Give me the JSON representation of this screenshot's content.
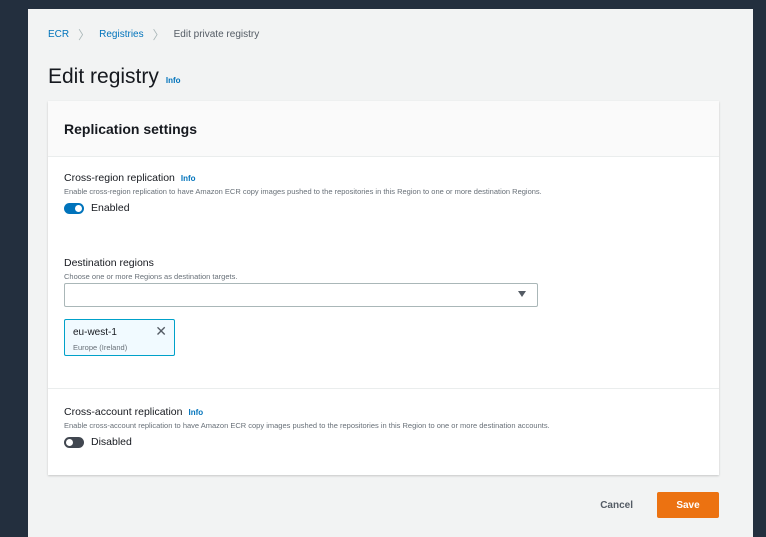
{
  "breadcrumb": {
    "items": [
      "ECR",
      "Registries"
    ],
    "current": "Edit private registry"
  },
  "header": {
    "title": "Edit registry",
    "info": "Info"
  },
  "replication": {
    "title": "Replication settings",
    "cross_region": {
      "label": "Cross-region replication",
      "info": "Info",
      "description": "Enable cross-region replication to have Amazon ECR copy images pushed to the repositories in this Region to one or more destination Regions.",
      "toggle_state": true,
      "toggle_label": "Enabled"
    },
    "destination": {
      "label": "Destination regions",
      "description": "Choose one or more Regions as destination targets.",
      "select_value": "",
      "tokens": [
        {
          "name": "eu-west-1",
          "region": "Europe (Ireland)"
        }
      ]
    },
    "cross_account": {
      "label": "Cross-account replication",
      "info": "Info",
      "description": "Enable cross-account replication to have Amazon ECR copy images pushed to the repositories in this Region to one or more destination accounts.",
      "toggle_state": false,
      "toggle_label": "Disabled"
    }
  },
  "actions": {
    "cancel": "Cancel",
    "save": "Save"
  },
  "colors": {
    "background": "#232f3e",
    "page": "#f2f3f3",
    "link": "#0073bb",
    "primary_button": "#ec7211",
    "toggle_on": "#0073bb",
    "toggle_off": "#414750"
  }
}
